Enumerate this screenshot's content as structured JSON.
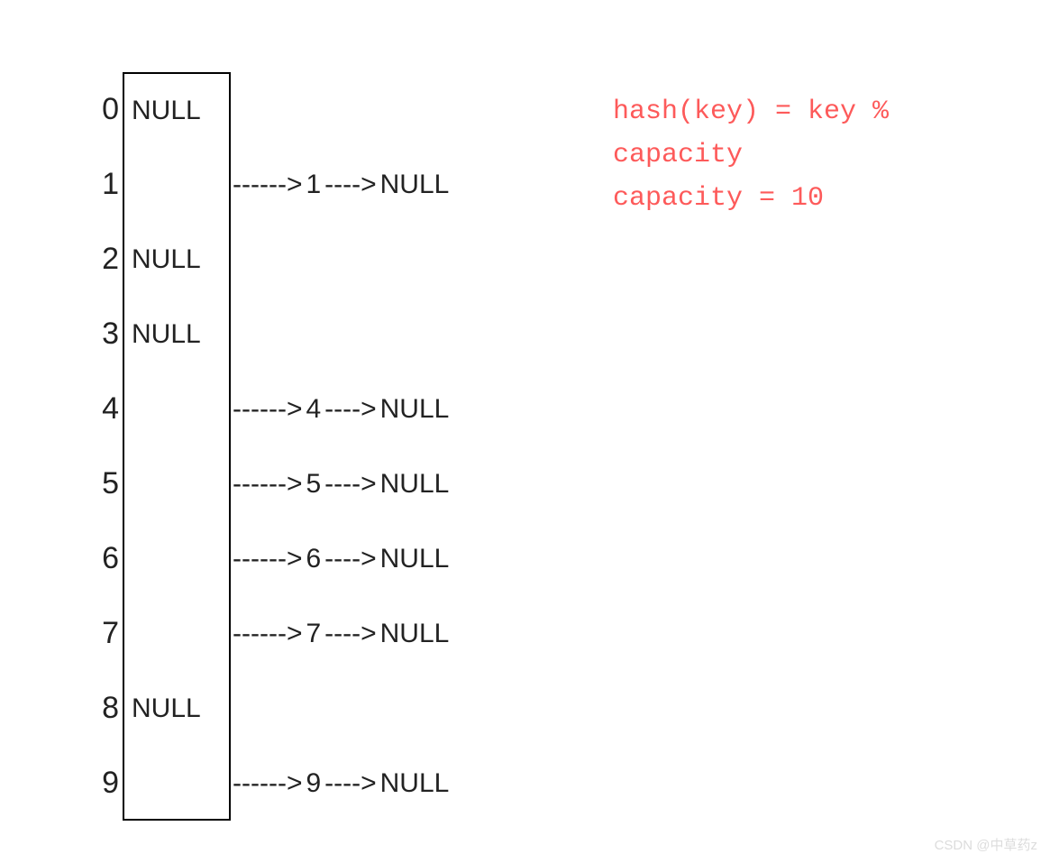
{
  "null_text": "NULL",
  "arrow1_text": "------>",
  "arrow2_text": "---->",
  "buckets": [
    {
      "index": "0",
      "content": "NULL",
      "chain": null
    },
    {
      "index": "1",
      "content": "",
      "chain": {
        "value": "1"
      }
    },
    {
      "index": "2",
      "content": "NULL",
      "chain": null
    },
    {
      "index": "3",
      "content": "NULL",
      "chain": null
    },
    {
      "index": "4",
      "content": "",
      "chain": {
        "value": "4"
      }
    },
    {
      "index": "5",
      "content": "",
      "chain": {
        "value": "5"
      }
    },
    {
      "index": "6",
      "content": "",
      "chain": {
        "value": "6"
      }
    },
    {
      "index": "7",
      "content": "",
      "chain": {
        "value": "7"
      }
    },
    {
      "index": "8",
      "content": "NULL",
      "chain": null
    },
    {
      "index": "9",
      "content": "",
      "chain": {
        "value": "9"
      }
    }
  ],
  "formula": {
    "line1": "hash(key) = key %",
    "line2": "capacity",
    "line3": "capacity = 10"
  },
  "watermark": "CSDN @中草药z"
}
